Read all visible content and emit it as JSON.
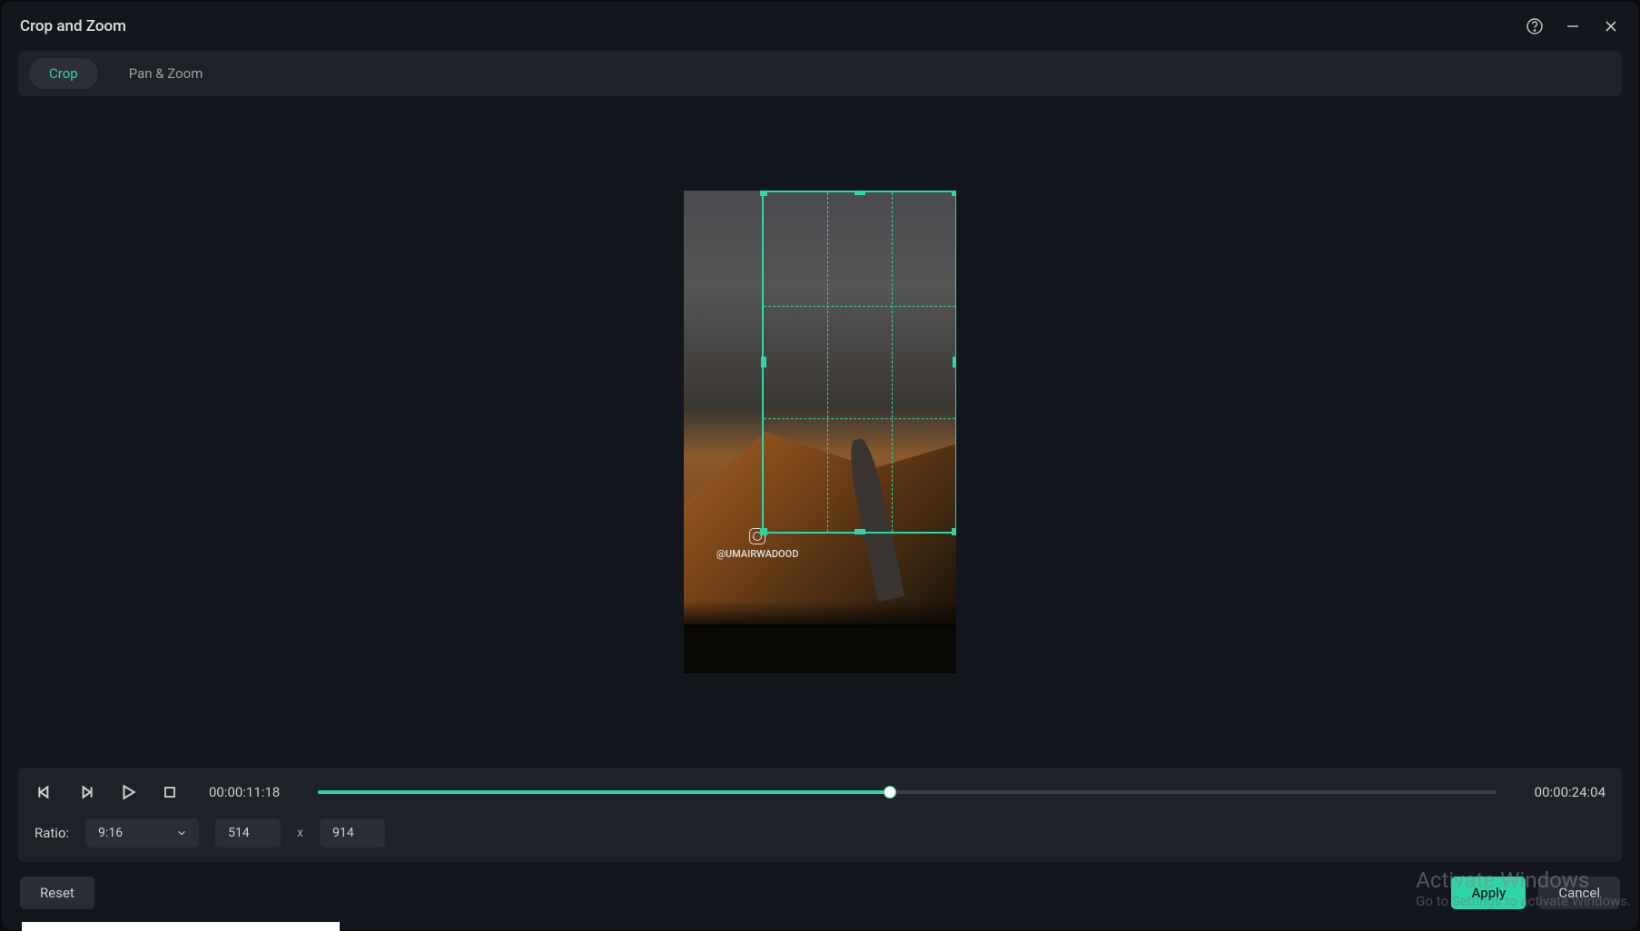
{
  "window": {
    "title": "Crop and Zoom"
  },
  "tabs": {
    "crop": "Crop",
    "panzoom": "Pan & Zoom"
  },
  "watermark": {
    "handle": "@UMAIRWADOOD"
  },
  "playback": {
    "current_time": "00:00:11:18",
    "total_time": "00:00:24:04"
  },
  "ratio": {
    "label": "Ratio:",
    "value": "9:16",
    "width": "514",
    "height": "914",
    "sep": "x"
  },
  "buttons": {
    "reset": "Reset",
    "apply": "Apply",
    "cancel": "Cancel"
  },
  "activate": {
    "title": "Activate Windows",
    "sub": "Go to Settings to activate Windows."
  },
  "colors": {
    "accent": "#2dd6a6"
  }
}
